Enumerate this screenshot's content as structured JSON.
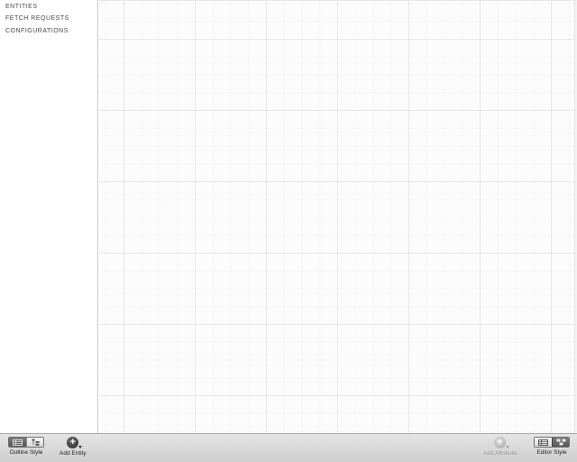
{
  "sidebar": {
    "sections": [
      {
        "label": "ENTITIES"
      },
      {
        "label": "FETCH REQUESTS"
      },
      {
        "label": "CONFIGURATIONS"
      }
    ]
  },
  "toolbar": {
    "outline_style": {
      "label": "Outline Style",
      "icons": [
        "table-icon",
        "tree-icon"
      ],
      "selected": "table"
    },
    "add_entity": {
      "label": "Add Entity",
      "icon": "plus-circle-icon"
    },
    "add_attribute": {
      "label": "Add Attribute",
      "icon": "plus-circle-icon",
      "enabled": false
    },
    "editor_style": {
      "label": "Editor Style",
      "icons": [
        "table-icon",
        "graph-icon"
      ],
      "selected": "graph"
    }
  },
  "colors": {
    "toolbar_bg": "#d9d9d9",
    "canvas_bg": "#fcfcfc",
    "grid_line": "#eeeeee"
  }
}
